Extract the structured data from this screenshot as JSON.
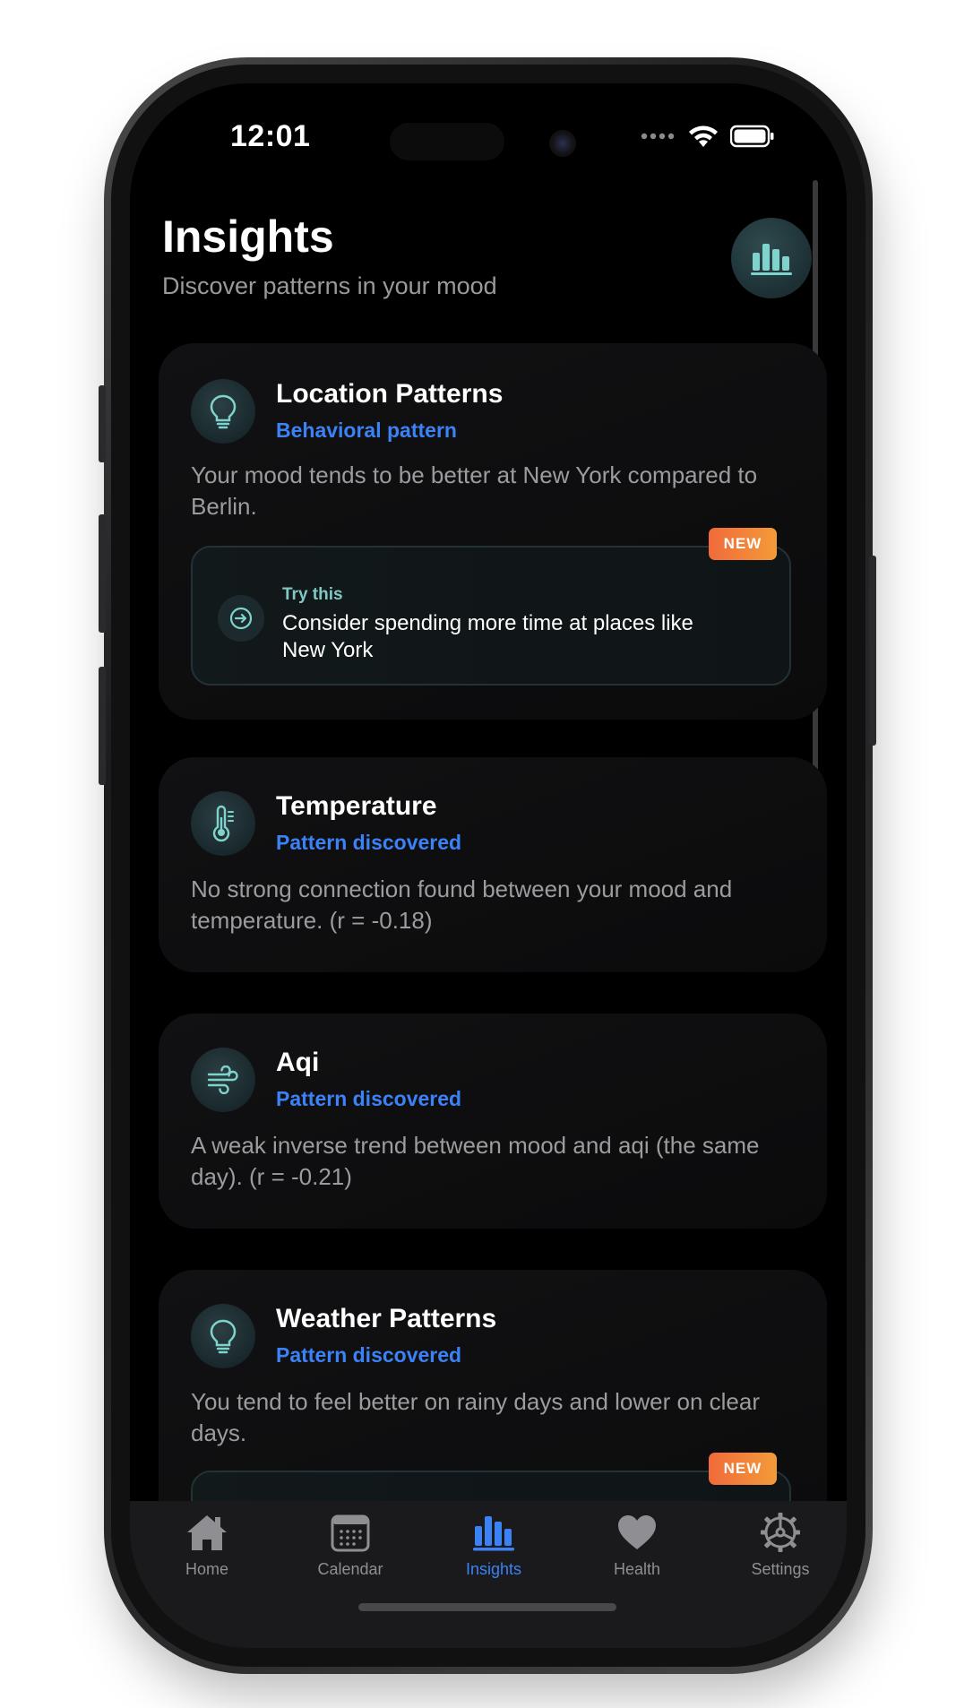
{
  "status_bar": {
    "time": "12:01"
  },
  "header": {
    "title": "Insights",
    "subtitle": "Discover patterns in your mood",
    "action_icon": "bar-chart-icon"
  },
  "cards": [
    {
      "icon": "lightbulb-icon",
      "title": "Location Patterns",
      "tag": "Behavioral pattern",
      "description": "Your mood tends to be better at New York compared to Berlin.",
      "tip": {
        "badge": "NEW",
        "label": "Try this",
        "text": "Consider spending more time at places like New York",
        "icon": "arrow-circle-icon"
      }
    },
    {
      "icon": "thermometer-icon",
      "title": "Temperature",
      "tag": "Pattern discovered",
      "description": "No strong connection found between your mood and temperature. (r = -0.18)"
    },
    {
      "icon": "wind-icon",
      "title": "Aqi",
      "tag": "Pattern discovered",
      "description": "A weak inverse trend between mood and aqi (the same day). (r = -0.21)"
    },
    {
      "icon": "lightbulb-icon",
      "title": "Weather Patterns",
      "tag": "Pattern discovered",
      "description": "You tend to feel better on rainy days and lower on clear days.",
      "tip": {
        "badge": "NEW"
      }
    }
  ],
  "tab_bar": {
    "items": [
      {
        "label": "Home",
        "icon": "home-icon"
      },
      {
        "label": "Calendar",
        "icon": "calendar-icon"
      },
      {
        "label": "Insights",
        "icon": "bar-chart-icon",
        "active": true
      },
      {
        "label": "Health",
        "icon": "heart-icon"
      },
      {
        "label": "Settings",
        "icon": "gear-icon"
      }
    ]
  },
  "colors": {
    "accent": "#3b82f6",
    "teal": "#7fc9c5",
    "badge_start": "#f16a3a",
    "badge_end": "#f39b39",
    "background": "#000000"
  }
}
